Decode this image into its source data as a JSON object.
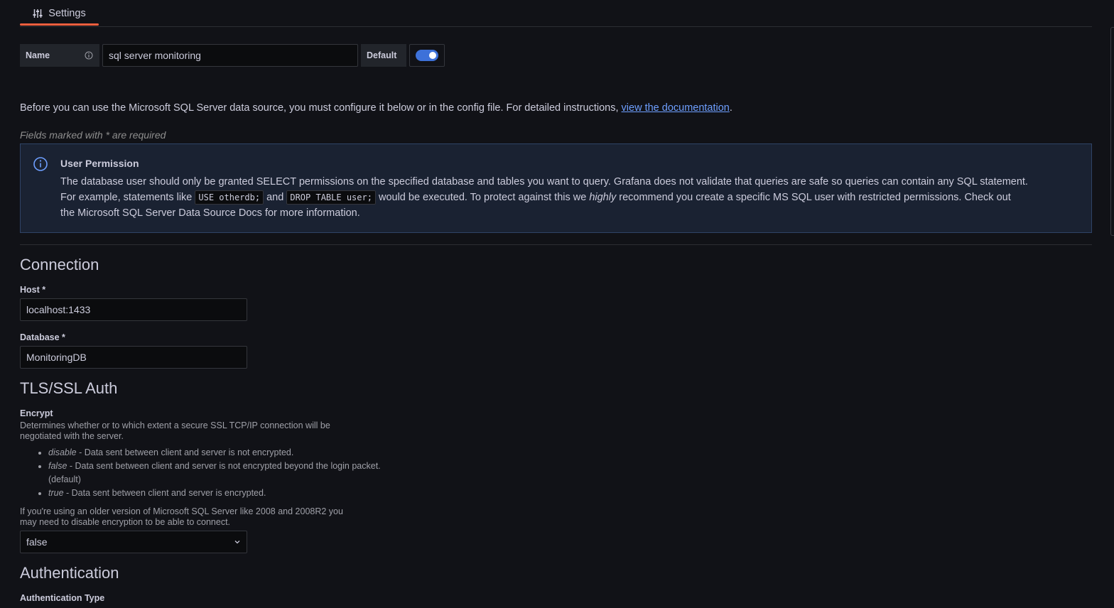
{
  "tabs": [
    {
      "label": "Settings"
    }
  ],
  "name_row": {
    "name_label": "Name",
    "name_value": "sql server monitoring",
    "default_label": "Default",
    "default_on": true
  },
  "intro": {
    "text": "Before you can use the Microsoft SQL Server data source, you must configure it below or in the config file. For detailed instructions, ",
    "link": "view the documentation",
    "end": "."
  },
  "required_note": "Fields marked with * are required",
  "alert": {
    "title": "User Permission",
    "p1": "The database user should only be granted SELECT permissions on the specified database and tables you want to query. Grafana does not validate that queries are safe so queries can contain any SQL statement.",
    "p2a": "For example, statements like ",
    "code1": "USE otherdb;",
    "p2b": " and ",
    "code2": "DROP TABLE user;",
    "p2c": " would be executed. To protect against this we ",
    "emph": "highly",
    "p2d": " recommend you create a specific MS SQL user with restricted permissions. Check out",
    "p3": "the Microsoft SQL Server Data Source Docs for more information."
  },
  "connection": {
    "heading": "Connection",
    "host_label": "Host *",
    "host_value": "localhost:1433",
    "database_label": "Database *",
    "database_value": "MonitoringDB"
  },
  "tls": {
    "heading": "TLS/SSL Auth",
    "encrypt_label": "Encrypt",
    "encrypt_desc": "Determines whether or to which extent a secure SSL TCP/IP connection will be negotiated with the server.",
    "options": [
      {
        "key": "disable",
        "text": " - Data sent between client and server is not encrypted."
      },
      {
        "key": "false",
        "text": " - Data sent between client and server is not encrypted beyond the login packet. (default)"
      },
      {
        "key": "true",
        "text": " - Data sent between client and server is encrypted."
      }
    ],
    "note": "If you're using an older version of Microsoft SQL Server like 2008 and 2008R2 you may need to disable encryption to be able to connect.",
    "encrypt_value": "false"
  },
  "authentication": {
    "heading": "Authentication",
    "type_label": "Authentication Type"
  },
  "colors": {
    "background": "#111217",
    "accent": "#f55f3e",
    "toggle": "#3d71d9",
    "link": "#6e9fff",
    "alert_bg": "#1a2232"
  }
}
